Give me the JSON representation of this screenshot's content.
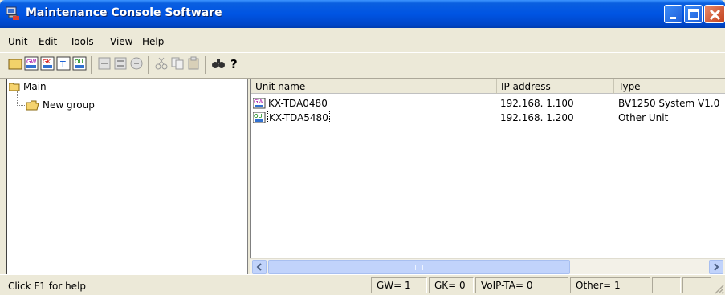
{
  "window": {
    "title": "Maintenance Console Software"
  },
  "menu": {
    "unit": "Unit",
    "edit": "Edit",
    "tools": "Tools",
    "view": "View",
    "help": "Help"
  },
  "toolbar": {
    "icons": [
      "new-icon",
      "gw-icon",
      "gk-icon",
      "ta-icon",
      "ou-icon",
      "connect-icon",
      "disconnect-icon",
      "stop-icon",
      "cut-icon",
      "copy-icon",
      "paste-icon",
      "find-icon",
      "help-icon"
    ]
  },
  "tree": {
    "root": "Main",
    "child": "New group"
  },
  "list": {
    "columns": [
      "Unit name",
      "IP address",
      "Type"
    ],
    "rows": [
      {
        "icon": "gw-unit-icon",
        "name": "KX-TDA0480",
        "ip": "192.168.  1.100",
        "type": "BV1250 System V1.0"
      },
      {
        "icon": "ou-unit-icon",
        "name": "KX-TDA5480",
        "ip": "192.168.  1.200",
        "type": "Other Unit"
      }
    ]
  },
  "status": {
    "help": "Click F1 for help",
    "gw": "GW=   1",
    "gk": "GK=   0",
    "voip": "VoIP-TA=   0",
    "other": "Other=   1"
  },
  "colors": {
    "titlebar": "#0054e3",
    "chrome": "#ece9d8",
    "close_button": "#c2401b"
  }
}
